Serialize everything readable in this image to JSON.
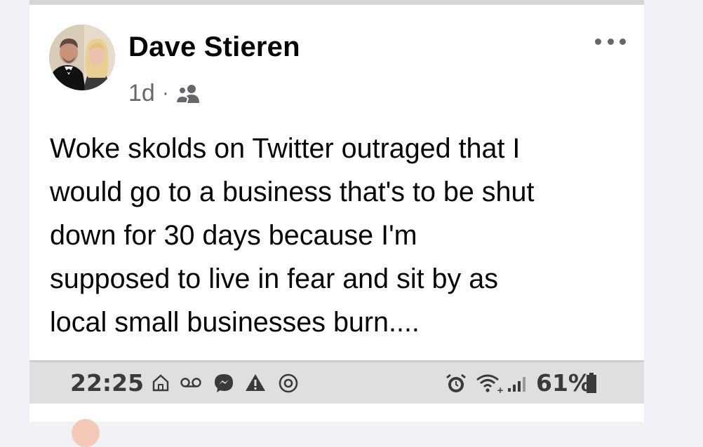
{
  "post": {
    "author": "Dave Stieren",
    "time": "1d",
    "separator": "·",
    "audience_icon": "friends-icon",
    "more_icon": "more-options-icon",
    "text": "Woke skolds on Twitter outraged that I\nwould go to a business that's to be shut\ndown for 30 days because I'm\nsupposed to live in fear and sit by as\nlocal small businesses burn...."
  },
  "status_bar": {
    "time": "22:25",
    "left_icons": [
      "home-icon",
      "voicemail-icon",
      "messenger-icon",
      "alert-triangle-icon",
      "at-sign-icon"
    ],
    "right_icons": [
      "alarm-icon",
      "wifi-icon",
      "signal-icon",
      "battery-icon"
    ],
    "battery": "61%"
  },
  "colors": {
    "background": "#f0f2f5",
    "card": "#ffffff",
    "text": "#050505",
    "secondary_text": "#65676b",
    "status_bar": "#dfdfdf"
  }
}
